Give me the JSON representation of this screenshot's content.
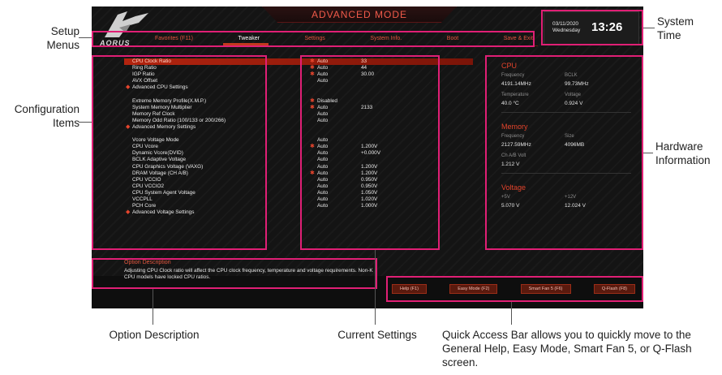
{
  "bios": {
    "mode_title": "ADVANCED MODE",
    "brand": "AORUS",
    "tabs": [
      {
        "label": "Favorites (F11)"
      },
      {
        "label": "Tweaker",
        "active": true
      },
      {
        "label": "Settings"
      },
      {
        "label": "System Info."
      },
      {
        "label": "Boot"
      },
      {
        "label": "Save & Exit"
      }
    ],
    "clock": {
      "date": "03/11/2020",
      "day": "Wednesday",
      "time": "13:26"
    },
    "settings_rows": [
      {
        "name": "CPU Clock Ratio",
        "setting": "Auto",
        "value": "33",
        "star": true,
        "highlight": true
      },
      {
        "name": "Ring Ratio",
        "setting": "Auto",
        "value": "44",
        "star": true
      },
      {
        "name": "IGP Ratio",
        "setting": "Auto",
        "value": "30.00",
        "star": true
      },
      {
        "name": "AVX Offset",
        "setting": "Auto",
        "value": ""
      },
      {
        "name": "Advanced CPU Settings",
        "bullet": true
      },
      {
        "gap": true
      },
      {
        "name": "Extreme Memory Profile(X.M.P.)",
        "setting": "Disabled",
        "value": "",
        "star": true
      },
      {
        "name": "System Memory Multiplier",
        "setting": "Auto",
        "value": "2133",
        "star": true
      },
      {
        "name": "Memory Ref Clock",
        "setting": "Auto",
        "value": ""
      },
      {
        "name": "Memory Odd Ratio (100/133 or 200/266)",
        "setting": "Auto",
        "value": ""
      },
      {
        "name": "Advanced Memory Settings",
        "bullet": true
      },
      {
        "gap": true
      },
      {
        "name": "Vcore Voltage Mode",
        "setting": "Auto",
        "value": ""
      },
      {
        "name": "CPU Vcore",
        "setting": "Auto",
        "value": "1.200V",
        "star": true
      },
      {
        "name": "Dynamic Vcore(DVID)",
        "setting": "Auto",
        "value": "+0.000V"
      },
      {
        "name": "BCLK Adaptive Voltage",
        "setting": "Auto",
        "value": ""
      },
      {
        "name": "CPU Graphics Voltage (VAXG)",
        "setting": "Auto",
        "value": "1.200V"
      },
      {
        "name": "DRAM Voltage    (CH A/B)",
        "setting": "Auto",
        "value": "1.200V",
        "star": true
      },
      {
        "name": "CPU VCCIO",
        "setting": "Auto",
        "value": "0.950V"
      },
      {
        "name": "CPU VCCIO2",
        "setting": "Auto",
        "value": "0.950V"
      },
      {
        "name": "CPU System Agent Voltage",
        "setting": "Auto",
        "value": "1.050V"
      },
      {
        "name": "VCCPLL",
        "setting": "Auto",
        "value": "1.020V"
      },
      {
        "name": "PCH Core",
        "setting": "Auto",
        "value": "1.000V"
      },
      {
        "name": "Advanced Voltage Settings",
        "bullet": true
      }
    ],
    "hardware": {
      "cpu": {
        "title": "CPU",
        "frequency_label": "Frequency",
        "frequency": "4191.14MHz",
        "bclk_label": "BCLK",
        "bclk": "99.73MHz",
        "temperature_label": "Temperature",
        "temperature": "40.0 °C",
        "voltage_label": "Voltage",
        "voltage": "0.924 V"
      },
      "memory": {
        "title": "Memory",
        "frequency_label": "Frequency",
        "frequency": "2127.59MHz",
        "size_label": "Size",
        "size": "4096MB",
        "volt_label": "Ch A/B Volt",
        "volt": "1.212 V"
      },
      "voltage": {
        "title": "Voltage",
        "p5v_label": "+5V",
        "p5v": "5.070 V",
        "p12v_label": "+12V",
        "p12v": "12.024 V"
      }
    },
    "option": {
      "title": "Option Description",
      "text": "Adjusting CPU Clock ratio will affect the CPU clock frequency, temperature and voltage requirements. Non-K CPU models have locked CPU ratios."
    },
    "quick_access": [
      {
        "label": "Help (F1)"
      },
      {
        "label": "Easy Mode (F2)"
      },
      {
        "label": "Smart Fan 5 (F6)"
      },
      {
        "label": "Q-Flash (F8)"
      }
    ]
  },
  "annotations": {
    "setup_menus": "Setup Menus",
    "configuration_items": "Configuration Items",
    "system_time": "System Time",
    "hardware_information": "Hardware Information",
    "option_description": "Option Description",
    "current_settings": "Current Settings",
    "quick_access": "Quick Access Bar allows you to quickly move to the General Help, Easy Mode, Smart Fan 5, or Q-Flash screen."
  },
  "colors": {
    "accent": "#e01f75",
    "bios_red": "#e5573f",
    "bios_bg": "#141414"
  }
}
